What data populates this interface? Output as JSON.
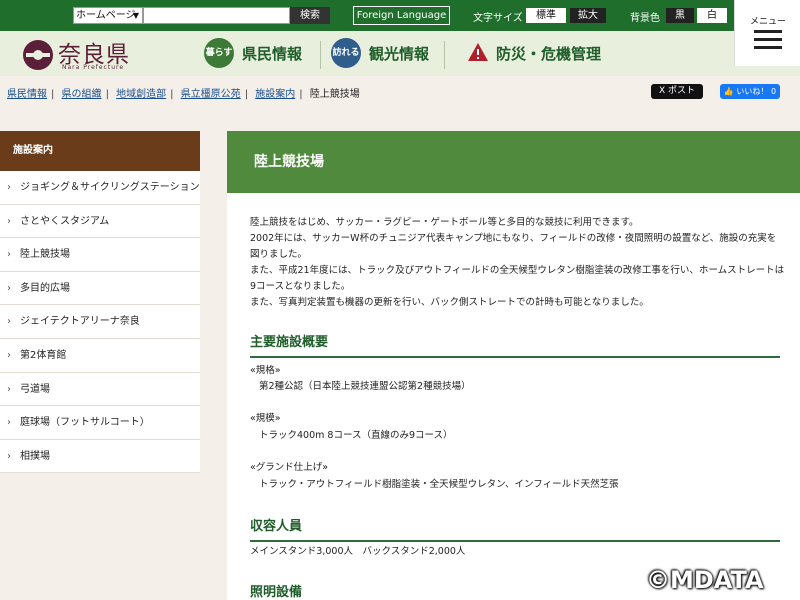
{
  "topbar": {
    "site_select": "ホームページ",
    "search_button": "検索",
    "foreign_language": "Foreign Language",
    "font_size_label": "文字サイズ",
    "font_size_standard": "標準",
    "font_size_large": "拡大",
    "bg_color_label": "背景色",
    "bg_black": "黒",
    "bg_white": "白",
    "menu_label": "メニュー"
  },
  "header": {
    "logo_text": "奈良県",
    "logo_sub": "Nara Prefecture",
    "nav": [
      {
        "badge": "暮らす",
        "label": "県民情報",
        "color": "#3d7a37"
      },
      {
        "badge": "訪れる",
        "label": "観光情報",
        "color": "#2f5d8c"
      },
      {
        "badge": "!",
        "label": "防災・危機管理",
        "color": "#b0202b"
      }
    ]
  },
  "breadcrumb": {
    "items": [
      "県民情報",
      "県の組織",
      "地域創造部",
      "県立橿原公苑",
      "施設案内"
    ],
    "current": "陸上競技場"
  },
  "social": {
    "x_post": "X ポスト",
    "fb_like": "👍 いいね！ 0"
  },
  "sidebar": {
    "heading": "施設案内",
    "items": [
      "ジョギング＆サイクリングステーション",
      "さとやくスタジアム",
      "陸上競技場",
      "多目的広場",
      "ジェイテクトアリーナ奈良",
      "第2体育館",
      "弓道場",
      "庭球場（フットサルコート）",
      "相撲場"
    ]
  },
  "main": {
    "title": "陸上競技場",
    "intro": [
      "陸上競技をはじめ、サッカー・ラグビー・ゲートボール等と多目的な競技に利用できます。",
      "2002年には、サッカーW杯のチュニジア代表キャンプ地にもなり、フィールドの改修・夜間照明の設置など、施設の充実を図りました。",
      "また、平成21年度には、トラック及びアウトフィールドの全天候型ウレタン樹脂塗装の改修工事を行い、ホームストレートは9コースとなりました。",
      "また、写真判定装置も機器の更新を行い、バック側ストレートでの計時も可能となりました。"
    ],
    "section_overview": "主要施設概要",
    "specs": [
      {
        "label": "«規格»",
        "value": "第2種公認（日本陸上競技連盟公認第2種競技場）"
      },
      {
        "label": "«規模»",
        "value": "トラック400m 8コース（直線のみ9コース）"
      },
      {
        "label": "«グランド仕上げ»",
        "value": "トラック・アウトフィールド樹脂塗装・全天候型ウレタン、インフィールド天然芝張"
      }
    ],
    "section_capacity": "収容人員",
    "capacity_text": "メインスタンド3,000人　バックスタンド2,000人",
    "section_lighting": "照明設備"
  },
  "watermark": "©MDATA"
}
